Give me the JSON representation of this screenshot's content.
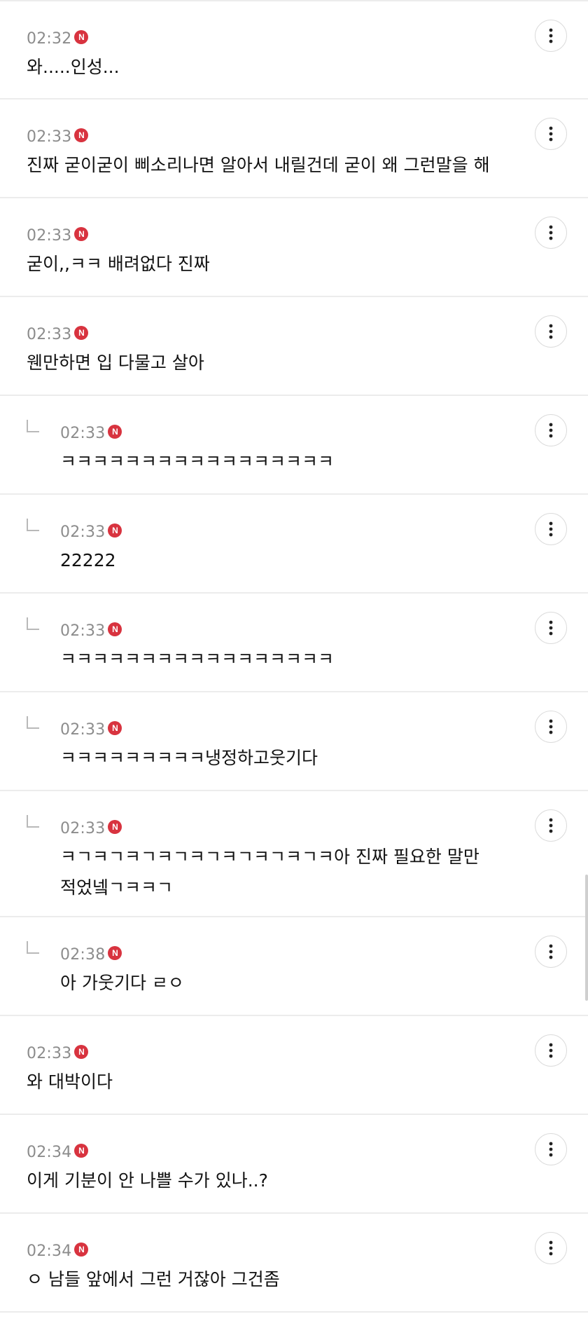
{
  "comments": [
    {
      "time": "02:32",
      "badge": "N",
      "text": "와.....인성...",
      "reply": false
    },
    {
      "time": "02:33",
      "badge": "N",
      "text": "진짜 굳이굳이 삐소리나면 알아서 내릴건데 굳이 왜 그런말을 해",
      "reply": false
    },
    {
      "time": "02:33",
      "badge": "N",
      "text": "굳이,,ㅋㅋ 배려없다 진짜",
      "reply": false
    },
    {
      "time": "02:33",
      "badge": "N",
      "text": "웬만하면 입 다물고 살아",
      "reply": false
    },
    {
      "time": "02:33",
      "badge": "N",
      "text": "ㅋㅋㅋㅋㅋㅋㅋㅋㅋㅋㅋㅋㅋㅋㅋㅋㅋ",
      "reply": true
    },
    {
      "time": "02:33",
      "badge": "N",
      "text": "22222",
      "reply": true
    },
    {
      "time": "02:33",
      "badge": "N",
      "text": "ㅋㅋㅋㅋㅋㅋㅋㅋㅋㅋㅋㅋㅋㅋㅋㅋㅋ",
      "reply": true
    },
    {
      "time": "02:33",
      "badge": "N",
      "text": "ㅋㅋㅋㅋㅋㅋㅋㅋㅋ냉정하고웃기다",
      "reply": true
    },
    {
      "time": "02:33",
      "badge": "N",
      "text": "ㅋㄱㅋㄱㅋㄱㅋㄱㅋㄱㅋㄱㅋㄱㅋㄱㅋ아 진짜 필요한 말만 적었넼ㄱㅋㅋㄱ",
      "reply": true
    },
    {
      "time": "02:38",
      "badge": "N",
      "text": "아 가웃기다 ㄹㅇ",
      "reply": true
    },
    {
      "time": "02:33",
      "badge": "N",
      "text": "와 대박이다",
      "reply": false
    },
    {
      "time": "02:34",
      "badge": "N",
      "text": "이게 기분이 안 나쁠 수가 있나..?",
      "reply": false
    },
    {
      "time": "02:34",
      "badge": "N",
      "text": "ㅇ 남들 앞에서 그런 거잖아 그건좀",
      "reply": false
    }
  ],
  "icons": {
    "more": "more-vertical-icon",
    "reply": "reply-arrow-icon",
    "new": "new-badge-icon"
  },
  "colors": {
    "badge": "#d8333f",
    "time": "#8c8c8c",
    "divider": "#ececec"
  }
}
